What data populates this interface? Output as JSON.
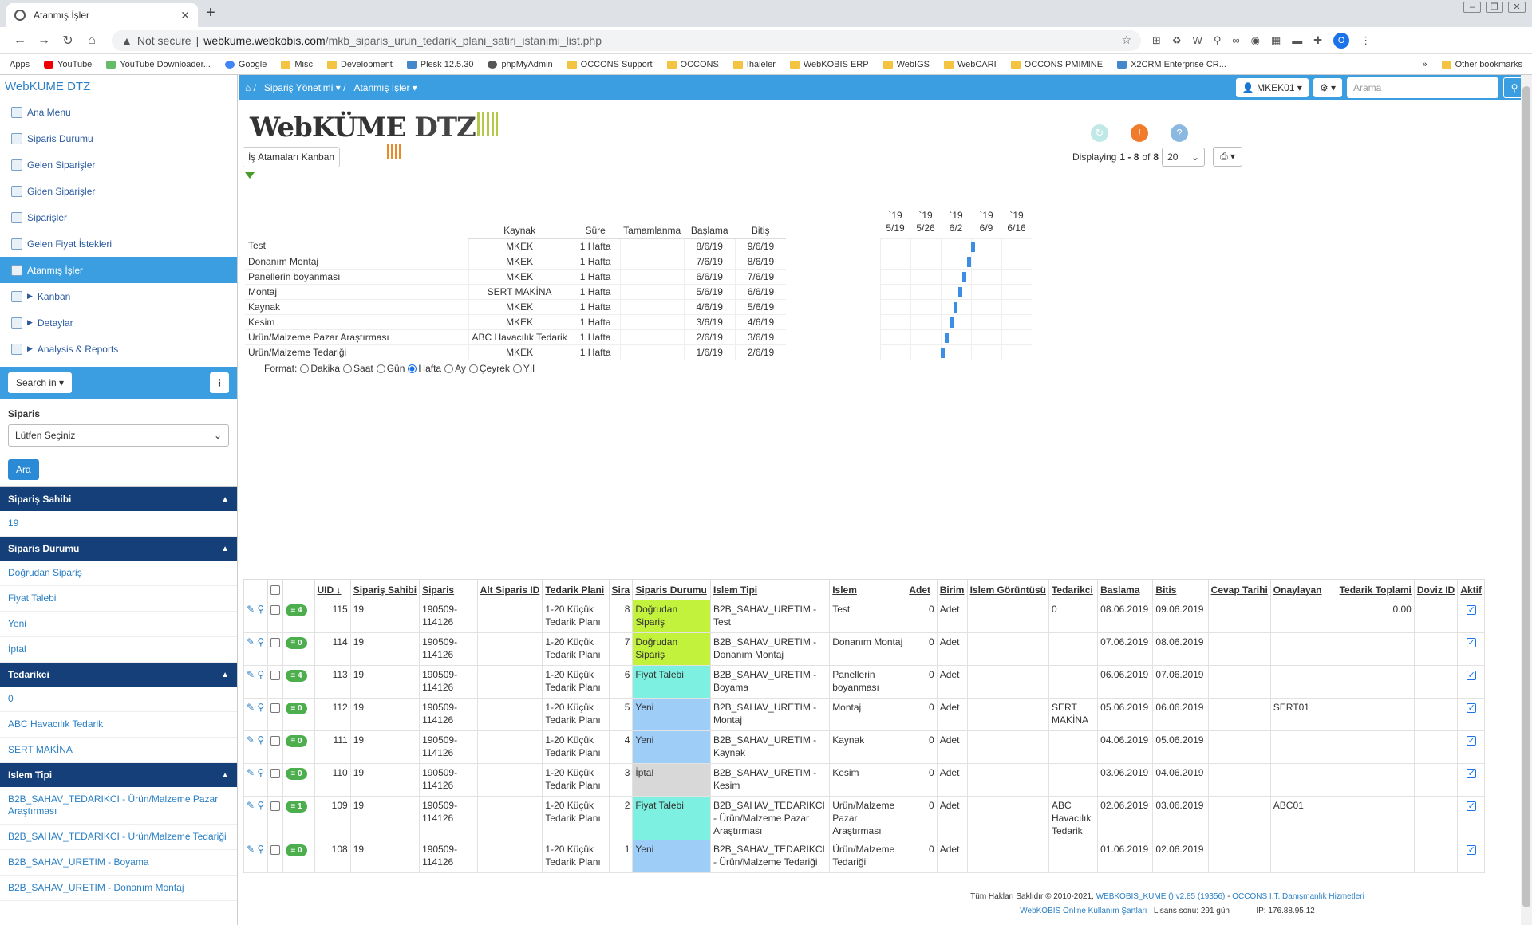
{
  "browser": {
    "tab_title": "Atanmış İşler",
    "not_secure": "Not secure",
    "url_host": "webkume.webkobis.com",
    "url_path": "/mkb_siparis_urun_tedarik_plani_satiri_istanimi_list.php",
    "profile": "O"
  },
  "bookmarks": [
    "Apps",
    "YouTube",
    "YouTube Downloader...",
    "Google",
    "Misc",
    "Development",
    "Plesk 12.5.30",
    "phpMyAdmin",
    "OCCONS Support",
    "OCCONS",
    "Ihaleler",
    "WebKOBIS ERP",
    "WebIGS",
    "WebCARI",
    "OCCONS PMIMINE",
    "X2CRM Enterprise CR..."
  ],
  "bookmarks_more": "»",
  "bookmarks_other": "Other bookmarks",
  "sidebar": {
    "brand": "WebKUME DTZ",
    "menu": [
      {
        "label": "Ana Menu"
      },
      {
        "label": "Siparis Durumu"
      },
      {
        "label": "Gelen Siparişler"
      },
      {
        "label": "Giden Siparişler"
      },
      {
        "label": "Siparişler"
      },
      {
        "label": "Gelen Fiyat İstekleri"
      },
      {
        "label": "Atanmış İşler",
        "active": true
      },
      {
        "label": "Kanban",
        "tree": true
      },
      {
        "label": "Detaylar",
        "tree": true
      },
      {
        "label": "Analysis & Reports",
        "tree": true
      }
    ],
    "search_in": "Search in",
    "filter_label": "Siparis",
    "filter_value": "Lütfen Seçiniz",
    "search_button": "Ara",
    "sections": [
      {
        "title": "Sipariş Sahibi",
        "options": [
          "19"
        ]
      },
      {
        "title": "Siparis Durumu",
        "options": [
          "Doğrudan Sipariş",
          "Fiyat Talebi",
          "Yeni",
          "İptal"
        ]
      },
      {
        "title": "Tedarikci",
        "options": [
          "0",
          "ABC Havacılık Tedarik",
          "SERT MAKİNA"
        ]
      },
      {
        "title": "Islem Tipi",
        "options": [
          "B2B_SAHAV_TEDARIKCI - Ürün/Malzeme Pazar Araştırması",
          "B2B_SAHAV_TEDARIKCI - Ürün/Malzeme Tedariği",
          "B2B_SAHAV_URETIM - Boyama",
          "B2B_SAHAV_URETIM - Donanım Montaj"
        ]
      }
    ]
  },
  "topnav": {
    "crumb1": "Sipariş Yönetimi",
    "crumb2": "Atanmış İşler",
    "user": "MKEK01",
    "search_placeholder": "Arama"
  },
  "logo": {
    "text": "WebKÜME",
    "dtz": "DTZ"
  },
  "toolbar": {
    "kanban": "İş Atamaları Kanban",
    "displaying_prefix": "Displaying",
    "range": "1 - 8",
    "of": "of",
    "total": "8",
    "page_size": "20"
  },
  "gantt": {
    "columns": [
      "Kaynak",
      "Süre",
      "Tamamlanma",
      "Başlama",
      "Bitiş"
    ],
    "weeks": [
      {
        "y": "`19",
        "d": "5/19"
      },
      {
        "y": "`19",
        "d": "5/26"
      },
      {
        "y": "`19",
        "d": "6/2"
      },
      {
        "y": "`19",
        "d": "6/9"
      },
      {
        "y": "`19",
        "d": "6/16"
      }
    ],
    "rows": [
      {
        "name": "Test",
        "kaynak": "MKEK",
        "sure": "1 Hafta",
        "tam": "",
        "bas": "8/6/19",
        "bit": "9/6/19",
        "day": 21
      },
      {
        "name": "Donanım Montaj",
        "kaynak": "MKEK",
        "sure": "1 Hafta",
        "tam": "",
        "bas": "7/6/19",
        "bit": "8/6/19",
        "day": 20
      },
      {
        "name": "Panellerin boyanması",
        "kaynak": "MKEK",
        "sure": "1 Hafta",
        "tam": "",
        "bas": "6/6/19",
        "bit": "7/6/19",
        "day": 19
      },
      {
        "name": "Montaj",
        "kaynak": "SERT MAKİNA",
        "sure": "1 Hafta",
        "tam": "",
        "bas": "5/6/19",
        "bit": "6/6/19",
        "day": 18
      },
      {
        "name": "Kaynak",
        "kaynak": "MKEK",
        "sure": "1 Hafta",
        "tam": "",
        "bas": "4/6/19",
        "bit": "5/6/19",
        "day": 17
      },
      {
        "name": "Kesim",
        "kaynak": "MKEK",
        "sure": "1 Hafta",
        "tam": "",
        "bas": "3/6/19",
        "bit": "4/6/19",
        "day": 16
      },
      {
        "name": "Ürün/Malzeme Pazar Araştırması",
        "kaynak": "ABC Havacılık Tedarik",
        "sure": "1 Hafta",
        "tam": "",
        "bas": "2/6/19",
        "bit": "3/6/19",
        "day": 15
      },
      {
        "name": "Ürün/Malzeme Tedariği",
        "kaynak": "MKEK",
        "sure": "1 Hafta",
        "tam": "",
        "bas": "1/6/19",
        "bit": "2/6/19",
        "day": 14
      }
    ],
    "format_label": "Format:",
    "formats": [
      "Dakika",
      "Saat",
      "Gün",
      "Hafta",
      "Ay",
      "Çeyrek",
      "Yıl"
    ],
    "format_selected": "Hafta"
  },
  "table": {
    "headers": [
      "UID",
      "Sipariş Sahibi",
      "Siparis",
      "Alt Siparis ID",
      "Tedarik Plani",
      "Sira",
      "Siparis Durumu",
      "Islem Tipi",
      "Islem",
      "Adet",
      "Birim",
      "Islem Görüntüsü",
      "Tedarikci",
      "Baslama",
      "Bitis",
      "Cevap Tarihi",
      "Onaylayan",
      "Tedarik Toplami",
      "Doviz ID",
      "Aktif"
    ],
    "rows": [
      {
        "cnt": "4",
        "uid": "115",
        "sahibi": "19",
        "siparis": "190509-114126",
        "alt": "",
        "plan": "1-20 Küçük Tedarik Planı",
        "sira": "8",
        "durum": "Doğrudan Sipariş",
        "dc": "st-green",
        "tip": "B2B_SAHAV_URETIM - Test",
        "islem": "Test",
        "adet": "0",
        "birim": "Adet",
        "gor": "",
        "ted": "0",
        "bas": "08.06.2019",
        "bit": "09.06.2019",
        "cevap": "",
        "onay": "",
        "toplam": "0.00",
        "doviz": ""
      },
      {
        "cnt": "0",
        "uid": "114",
        "sahibi": "19",
        "siparis": "190509-114126",
        "alt": "",
        "plan": "1-20 Küçük Tedarik Planı",
        "sira": "7",
        "durum": "Doğrudan Sipariş",
        "dc": "st-green",
        "tip": "B2B_SAHAV_URETIM - Donanım Montaj",
        "islem": "Donanım Montaj",
        "adet": "0",
        "birim": "Adet",
        "gor": "",
        "ted": "",
        "bas": "07.06.2019",
        "bit": "08.06.2019",
        "cevap": "",
        "onay": "",
        "toplam": "",
        "doviz": ""
      },
      {
        "cnt": "4",
        "uid": "113",
        "sahibi": "19",
        "siparis": "190509-114126",
        "alt": "",
        "plan": "1-20 Küçük Tedarik Planı",
        "sira": "6",
        "durum": "Fiyat Talebi",
        "dc": "st-cyan",
        "tip": "B2B_SAHAV_URETIM - Boyama",
        "islem": "Panellerin boyanması",
        "adet": "0",
        "birim": "Adet",
        "gor": "",
        "ted": "",
        "bas": "06.06.2019",
        "bit": "07.06.2019",
        "cevap": "",
        "onay": "",
        "toplam": "",
        "doviz": ""
      },
      {
        "cnt": "0",
        "uid": "112",
        "sahibi": "19",
        "siparis": "190509-114126",
        "alt": "",
        "plan": "1-20 Küçük Tedarik Planı",
        "sira": "5",
        "durum": "Yeni",
        "dc": "st-blue",
        "tip": "B2B_SAHAV_URETIM - Montaj",
        "islem": "Montaj",
        "adet": "0",
        "birim": "Adet",
        "gor": "",
        "ted": "SERT MAKİNA",
        "bas": "05.06.2019",
        "bit": "06.06.2019",
        "cevap": "",
        "onay": "SERT01",
        "toplam": "",
        "doviz": ""
      },
      {
        "cnt": "0",
        "uid": "111",
        "sahibi": "19",
        "siparis": "190509-114126",
        "alt": "",
        "plan": "1-20 Küçük Tedarik Planı",
        "sira": "4",
        "durum": "Yeni",
        "dc": "st-blue",
        "tip": "B2B_SAHAV_URETIM - Kaynak",
        "islem": "Kaynak",
        "adet": "0",
        "birim": "Adet",
        "gor": "",
        "ted": "",
        "bas": "04.06.2019",
        "bit": "05.06.2019",
        "cevap": "",
        "onay": "",
        "toplam": "",
        "doviz": ""
      },
      {
        "cnt": "0",
        "uid": "110",
        "sahibi": "19",
        "siparis": "190509-114126",
        "alt": "",
        "plan": "1-20 Küçük Tedarik Planı",
        "sira": "3",
        "durum": "İptal",
        "dc": "st-grey",
        "tip": "B2B_SAHAV_URETIM - Kesim",
        "islem": "Kesim",
        "adet": "0",
        "birim": "Adet",
        "gor": "",
        "ted": "",
        "bas": "03.06.2019",
        "bit": "04.06.2019",
        "cevap": "",
        "onay": "",
        "toplam": "",
        "doviz": ""
      },
      {
        "cnt": "1",
        "uid": "109",
        "sahibi": "19",
        "siparis": "190509-114126",
        "alt": "",
        "plan": "1-20 Küçük Tedarik Planı",
        "sira": "2",
        "durum": "Fiyat Talebi",
        "dc": "st-cyan",
        "tip": "B2B_SAHAV_TEDARIKCI - Ürün/Malzeme Pazar Araştırması",
        "islem": "Ürün/Malzeme Pazar Araştırması",
        "adet": "0",
        "birim": "Adet",
        "gor": "",
        "ted": "ABC Havacılık Tedarik",
        "bas": "02.06.2019",
        "bit": "03.06.2019",
        "cevap": "",
        "onay": "ABC01",
        "toplam": "",
        "doviz": ""
      },
      {
        "cnt": "0",
        "uid": "108",
        "sahibi": "19",
        "siparis": "190509-114126",
        "alt": "",
        "plan": "1-20 Küçük Tedarik Planı",
        "sira": "1",
        "durum": "Yeni",
        "dc": "st-blue",
        "tip": "B2B_SAHAV_TEDARIKCI - Ürün/Malzeme Tedariği",
        "islem": "Ürün/Malzeme Tedariği",
        "adet": "0",
        "birim": "Adet",
        "gor": "",
        "ted": "",
        "bas": "01.06.2019",
        "bit": "02.06.2019",
        "cevap": "",
        "onay": "",
        "toplam": "",
        "doviz": ""
      }
    ]
  },
  "footer": {
    "copy": "Tüm Hakları Saklıdır © 2010-2021,",
    "link1": "WEBKOBIS_KUME () v2.85 (19356)",
    "sep": "-",
    "link2": "OCCONS I.T. Danışmanlık Hizmetleri",
    "link3": "WebKOBIS Online Kullanım Şartları",
    "license": "Lisans sonu: 291 gün",
    "ip": "IP: 176.88.95.12"
  },
  "colors": {
    "accent": "#3a9ee0",
    "section": "#143f78",
    "green": "#c2f23c",
    "cyan": "#7df0e2",
    "blue": "#9ecdf7",
    "grey": "#d8d8d8"
  }
}
